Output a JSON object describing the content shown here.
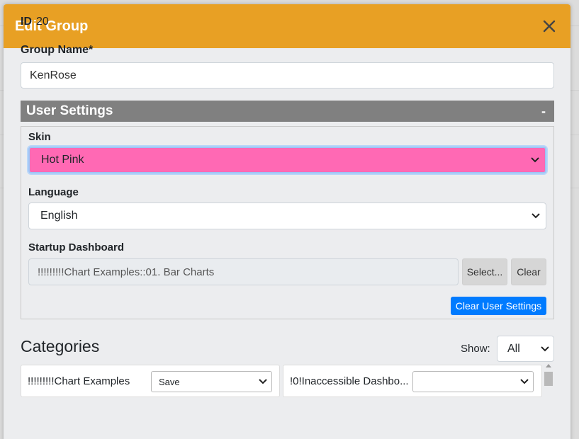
{
  "modal": {
    "title": "Edit Group"
  },
  "id_field": {
    "label": "ID",
    "value": "20"
  },
  "group_name": {
    "label": "Group Name*",
    "value": "KenRose"
  },
  "user_settings": {
    "title": "User Settings",
    "toggle": "-",
    "skin": {
      "label": "Skin",
      "value": "Hot Pink",
      "color": "#ff69b4"
    },
    "language": {
      "label": "Language",
      "value": "English"
    },
    "startup_dashboard": {
      "label": "Startup Dashboard",
      "value": "!!!!!!!!!Chart Examples::01. Bar Charts",
      "select_label": "Select...",
      "clear_label": "Clear"
    },
    "clear_settings_label": "Clear User Settings"
  },
  "categories": {
    "title": "Categories",
    "show_label": "Show:",
    "show_value": "All",
    "items": [
      {
        "name": "!!!!!!!!!Chart Examples",
        "value": "Save"
      },
      {
        "name": "!0!Inaccessible Dashbo...",
        "value": ""
      }
    ]
  },
  "colors": {
    "header": "#e8a024",
    "section_bar": "#808080",
    "primary": "#007bff"
  }
}
